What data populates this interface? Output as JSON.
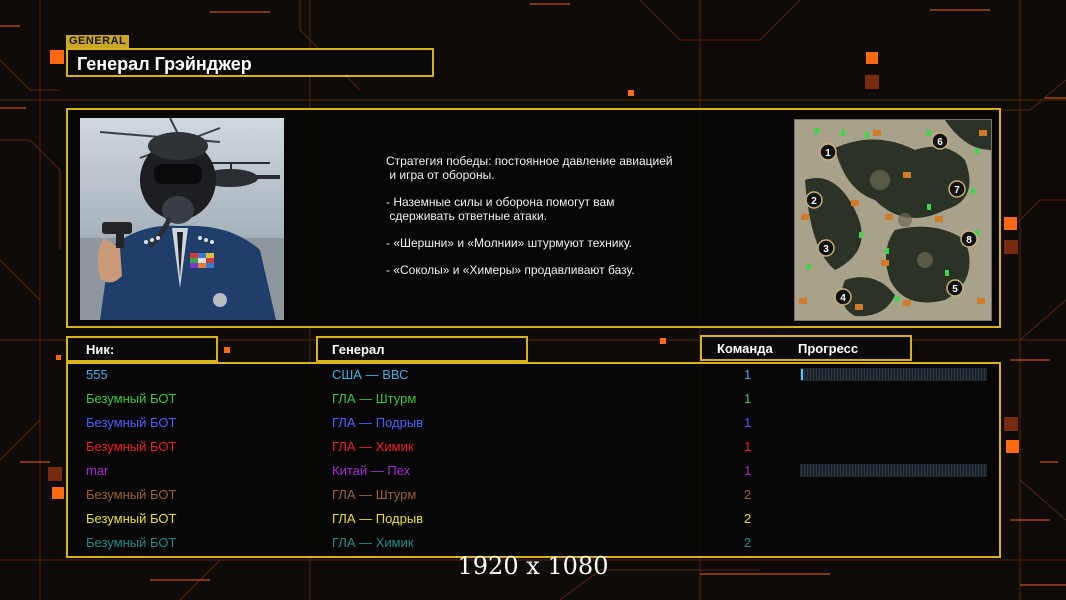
{
  "header": {
    "tag": "GENERAL",
    "general_name": "Генерал Грэйнджер"
  },
  "strategy": {
    "lines": [
      "Стратегия победы: постоянное давление авиацией\n и игра от обороны.",
      "- Наземные силы и оборона помогут вам\n сдерживать ответные атаки.",
      "- «Шершни» и «Молнии» штурмуют технику.",
      "- «Соколы» и «Химеры» продавливают базу."
    ]
  },
  "minimap": {
    "start_positions": [
      "1",
      "2",
      "3",
      "4",
      "5",
      "6",
      "7",
      "8"
    ]
  },
  "columns": {
    "nick": "Ник:",
    "general": "Генерал",
    "team": "Команда",
    "progress": "Прогресс"
  },
  "players": [
    {
      "nick": "555",
      "general": "США — ВВС",
      "team": "1",
      "color": "#3fb0e6",
      "progress": 0.01
    },
    {
      "nick": "Безумный БОТ",
      "general": "ГЛА — Штурм",
      "team": "1",
      "color": "#3cc83c",
      "progress": null
    },
    {
      "nick": "Безумный БОТ",
      "general": "ГЛА — Подрыв",
      "team": "1",
      "color": "#4a62ff",
      "progress": null
    },
    {
      "nick": "Безумный БОТ",
      "general": "ГЛА — Химик",
      "team": "1",
      "color": "#e82323",
      "progress": null
    },
    {
      "nick": "mar",
      "general": "Китай — Пех",
      "team": "1",
      "color": "#a22ad6",
      "progress": 0.0
    },
    {
      "nick": "Безумный БОТ",
      "general": "ГЛА — Штурм",
      "team": "2",
      "color": "#9a6236",
      "progress": null
    },
    {
      "nick": "Безумный БОТ",
      "general": "ГЛА — Подрыв",
      "team": "2",
      "color": "#e8e028",
      "progress": null
    },
    {
      "nick": "Безумный БОТ",
      "general": "ГЛА — Химик",
      "team": "2",
      "color": "#218a8e",
      "progress": null
    }
  ],
  "footer": {
    "resolution": "1920 x 1080"
  },
  "colors": {
    "frame": "#d9b21a",
    "accent_square": "#ff6a10"
  }
}
